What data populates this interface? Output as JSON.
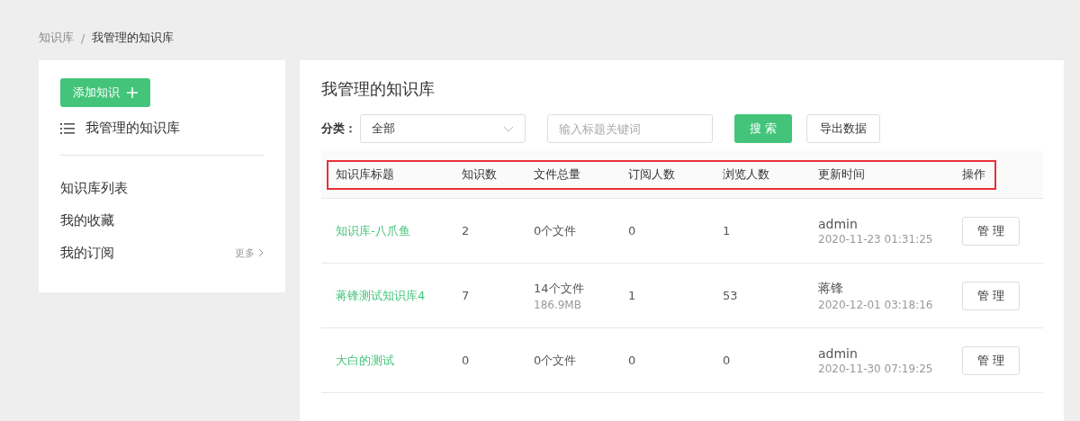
{
  "breadcrumb": [
    {
      "label": "知识库",
      "current": false
    },
    {
      "label": "我管理的知识库",
      "current": true
    }
  ],
  "breadcrumb_separator": "/",
  "sidebar": {
    "add_button": "添加知识",
    "section_title": "我管理的知识库",
    "items": [
      {
        "label": "知识库列表"
      },
      {
        "label": "我的收藏"
      },
      {
        "label": "我的订阅",
        "more": "更多"
      }
    ]
  },
  "main": {
    "title": "我管理的知识库",
    "filter": {
      "label": "分类：",
      "category": "全部",
      "search": {
        "placeholder": "输入标题关键词"
      },
      "search_button": "搜 索",
      "export_button": "导出数据"
    },
    "table": {
      "header_highlighted": true,
      "columns": [
        "知识库标题",
        "知识数",
        "文件总量",
        "订阅人数",
        "浏览人数",
        "更新时间",
        "操作"
      ],
      "rows": [
        {
          "title": "知识库-八爪鱼",
          "count": "2",
          "files": "0个文件",
          "subscribers": "0",
          "views": "1",
          "updater": "admin",
          "time": "2020-11-23 01:31:25",
          "action": "管 理"
        },
        {
          "title": "蒋锋测试知识库4",
          "count": "7",
          "files": "14个文件",
          "size": "186.9MB",
          "subscribers": "1",
          "views": "53",
          "updater": "蒋锋",
          "time": "2020-12-01 03:18:16",
          "action": "管 理"
        },
        {
          "title": "大白的测试",
          "count": "0",
          "files": "0个文件",
          "subscribers": "0",
          "views": "0",
          "updater": "admin",
          "time": "2020-11-30 07:19:25",
          "action": "管 理"
        }
      ]
    }
  }
}
